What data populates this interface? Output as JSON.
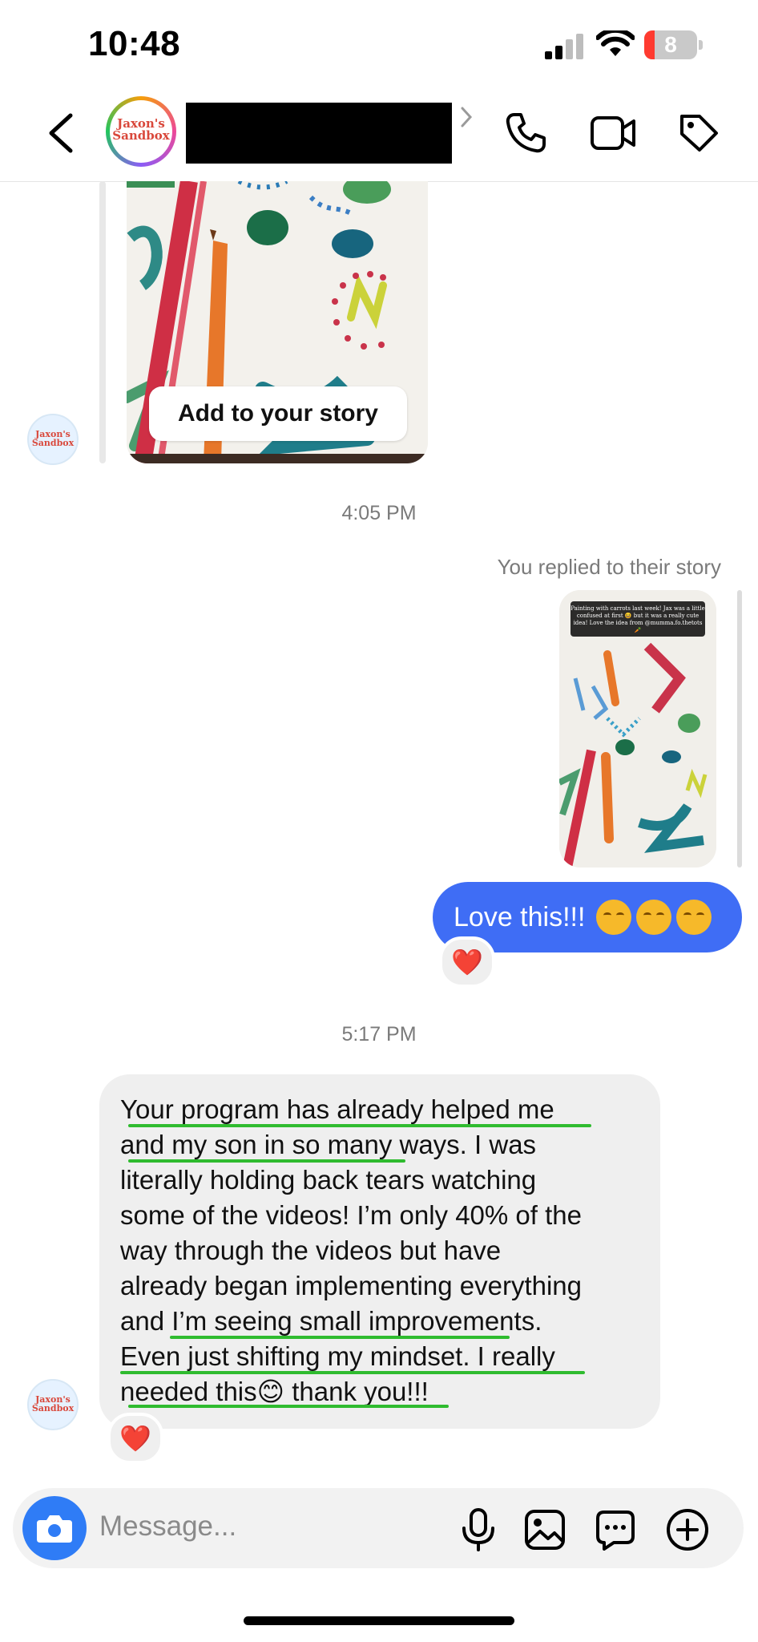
{
  "status_bar": {
    "time": "10:48",
    "battery": "8"
  },
  "header": {
    "contact_logo": "Jaxon's Sandbox"
  },
  "story": {
    "add_to_story_label": "Add to your story"
  },
  "thread": {
    "timestamp_1": "4:05 PM",
    "reply_context": "You replied to their story",
    "reply_caption": "Painting with carrots last week! Jax was a little confused at first 😆 but it was a really cute idea! Love the idea from @mumma.fo.thetots 🥕",
    "sent_message": "Love this!!!",
    "sent_reaction": "❤️",
    "timestamp_2": "5:17 PM",
    "received_message": {
      "lines": [
        "Your program has already helped me",
        "and my son in so many ways. I was",
        "literally holding back tears watching",
        "some of the videos! I’m only 40% of the",
        "way through the videos but have",
        "already began implementing everything",
        "and I’m seeing small improvements.",
        "Even just shifting my mindset. I really",
        "needed this😊 thank you!!!"
      ]
    },
    "received_reaction": "❤️"
  },
  "composer": {
    "placeholder": "Message..."
  },
  "icons": {
    "back": "chevron-left-icon",
    "phone": "phone-icon",
    "video": "video-camera-icon",
    "tag": "tag-icon",
    "camera": "camera-icon",
    "mic": "microphone-icon",
    "gallery": "image-icon",
    "sticker": "chat-bubble-icon",
    "add": "plus-circle-icon"
  },
  "colors": {
    "sent_bubble": "#3f6df5",
    "received_bubble": "#efefef",
    "highlight": "#2fbb2f",
    "camera_button": "#2f7cf6"
  }
}
